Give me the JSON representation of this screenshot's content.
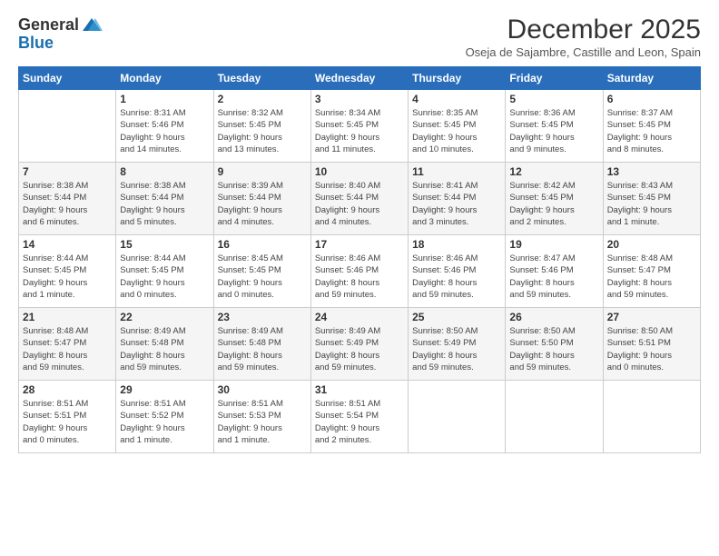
{
  "header": {
    "logo_general": "General",
    "logo_blue": "Blue",
    "month_title": "December 2025",
    "subtitle": "Oseja de Sajambre, Castille and Leon, Spain"
  },
  "calendar": {
    "days_of_week": [
      "Sunday",
      "Monday",
      "Tuesday",
      "Wednesday",
      "Thursday",
      "Friday",
      "Saturday"
    ],
    "weeks": [
      [
        {
          "date": "",
          "info": ""
        },
        {
          "date": "1",
          "info": "Sunrise: 8:31 AM\nSunset: 5:46 PM\nDaylight: 9 hours\nand 14 minutes."
        },
        {
          "date": "2",
          "info": "Sunrise: 8:32 AM\nSunset: 5:45 PM\nDaylight: 9 hours\nand 13 minutes."
        },
        {
          "date": "3",
          "info": "Sunrise: 8:34 AM\nSunset: 5:45 PM\nDaylight: 9 hours\nand 11 minutes."
        },
        {
          "date": "4",
          "info": "Sunrise: 8:35 AM\nSunset: 5:45 PM\nDaylight: 9 hours\nand 10 minutes."
        },
        {
          "date": "5",
          "info": "Sunrise: 8:36 AM\nSunset: 5:45 PM\nDaylight: 9 hours\nand 9 minutes."
        },
        {
          "date": "6",
          "info": "Sunrise: 8:37 AM\nSunset: 5:45 PM\nDaylight: 9 hours\nand 8 minutes."
        }
      ],
      [
        {
          "date": "7",
          "info": "Sunrise: 8:38 AM\nSunset: 5:44 PM\nDaylight: 9 hours\nand 6 minutes."
        },
        {
          "date": "8",
          "info": "Sunrise: 8:38 AM\nSunset: 5:44 PM\nDaylight: 9 hours\nand 5 minutes."
        },
        {
          "date": "9",
          "info": "Sunrise: 8:39 AM\nSunset: 5:44 PM\nDaylight: 9 hours\nand 4 minutes."
        },
        {
          "date": "10",
          "info": "Sunrise: 8:40 AM\nSunset: 5:44 PM\nDaylight: 9 hours\nand 4 minutes."
        },
        {
          "date": "11",
          "info": "Sunrise: 8:41 AM\nSunset: 5:44 PM\nDaylight: 9 hours\nand 3 minutes."
        },
        {
          "date": "12",
          "info": "Sunrise: 8:42 AM\nSunset: 5:45 PM\nDaylight: 9 hours\nand 2 minutes."
        },
        {
          "date": "13",
          "info": "Sunrise: 8:43 AM\nSunset: 5:45 PM\nDaylight: 9 hours\nand 1 minute."
        }
      ],
      [
        {
          "date": "14",
          "info": "Sunrise: 8:44 AM\nSunset: 5:45 PM\nDaylight: 9 hours\nand 1 minute."
        },
        {
          "date": "15",
          "info": "Sunrise: 8:44 AM\nSunset: 5:45 PM\nDaylight: 9 hours\nand 0 minutes."
        },
        {
          "date": "16",
          "info": "Sunrise: 8:45 AM\nSunset: 5:45 PM\nDaylight: 9 hours\nand 0 minutes."
        },
        {
          "date": "17",
          "info": "Sunrise: 8:46 AM\nSunset: 5:46 PM\nDaylight: 8 hours\nand 59 minutes."
        },
        {
          "date": "18",
          "info": "Sunrise: 8:46 AM\nSunset: 5:46 PM\nDaylight: 8 hours\nand 59 minutes."
        },
        {
          "date": "19",
          "info": "Sunrise: 8:47 AM\nSunset: 5:46 PM\nDaylight: 8 hours\nand 59 minutes."
        },
        {
          "date": "20",
          "info": "Sunrise: 8:48 AM\nSunset: 5:47 PM\nDaylight: 8 hours\nand 59 minutes."
        }
      ],
      [
        {
          "date": "21",
          "info": "Sunrise: 8:48 AM\nSunset: 5:47 PM\nDaylight: 8 hours\nand 59 minutes."
        },
        {
          "date": "22",
          "info": "Sunrise: 8:49 AM\nSunset: 5:48 PM\nDaylight: 8 hours\nand 59 minutes."
        },
        {
          "date": "23",
          "info": "Sunrise: 8:49 AM\nSunset: 5:48 PM\nDaylight: 8 hours\nand 59 minutes."
        },
        {
          "date": "24",
          "info": "Sunrise: 8:49 AM\nSunset: 5:49 PM\nDaylight: 8 hours\nand 59 minutes."
        },
        {
          "date": "25",
          "info": "Sunrise: 8:50 AM\nSunset: 5:49 PM\nDaylight: 8 hours\nand 59 minutes."
        },
        {
          "date": "26",
          "info": "Sunrise: 8:50 AM\nSunset: 5:50 PM\nDaylight: 8 hours\nand 59 minutes."
        },
        {
          "date": "27",
          "info": "Sunrise: 8:50 AM\nSunset: 5:51 PM\nDaylight: 9 hours\nand 0 minutes."
        }
      ],
      [
        {
          "date": "28",
          "info": "Sunrise: 8:51 AM\nSunset: 5:51 PM\nDaylight: 9 hours\nand 0 minutes."
        },
        {
          "date": "29",
          "info": "Sunrise: 8:51 AM\nSunset: 5:52 PM\nDaylight: 9 hours\nand 1 minute."
        },
        {
          "date": "30",
          "info": "Sunrise: 8:51 AM\nSunset: 5:53 PM\nDaylight: 9 hours\nand 1 minute."
        },
        {
          "date": "31",
          "info": "Sunrise: 8:51 AM\nSunset: 5:54 PM\nDaylight: 9 hours\nand 2 minutes."
        },
        {
          "date": "",
          "info": ""
        },
        {
          "date": "",
          "info": ""
        },
        {
          "date": "",
          "info": ""
        }
      ]
    ]
  }
}
